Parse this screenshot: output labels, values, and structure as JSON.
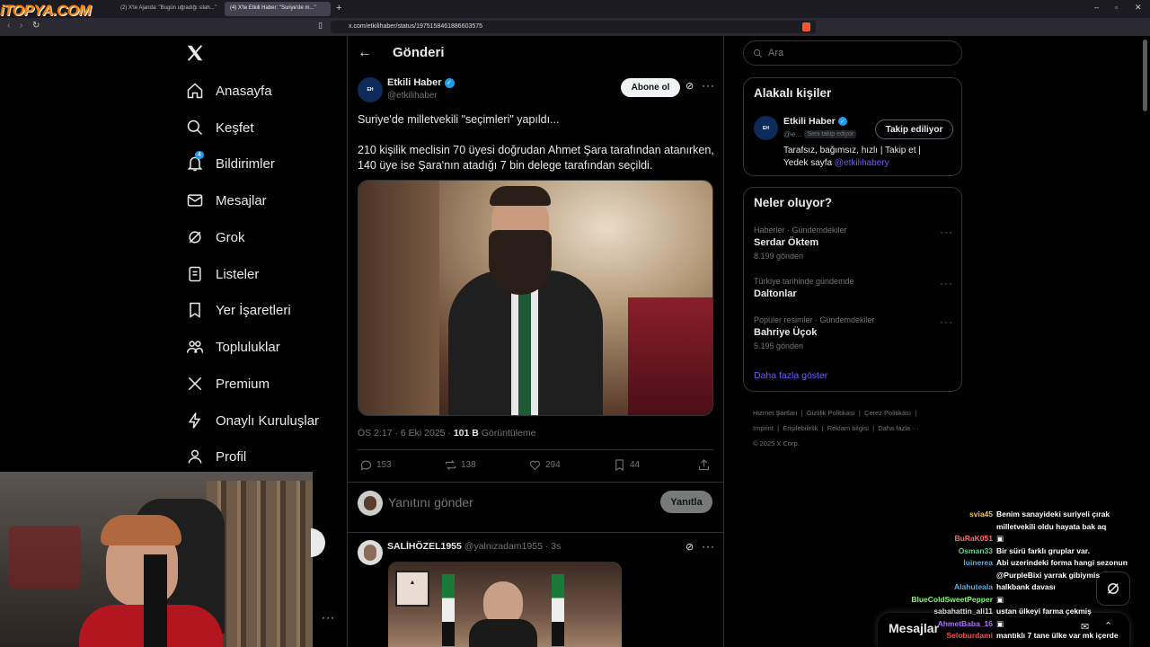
{
  "browser": {
    "brand": "iTOPYA.COM",
    "tabs": [
      {
        "label": "(2) X'te Ajanda: \"Bugün uğradığı silah...\""
      },
      {
        "label": "(4) X'te Etkili Haber: \"Suriye'de m...\""
      }
    ],
    "url": "x.com/etkilihaber/status/1975158461886603575"
  },
  "nav": {
    "items": [
      {
        "label": "Anasayfa"
      },
      {
        "label": "Keşfet"
      },
      {
        "label": "Bildirimler",
        "badge": "4"
      },
      {
        "label": "Mesajlar"
      },
      {
        "label": "Grok"
      },
      {
        "label": "Listeler"
      },
      {
        "label": "Yer İşaretleri"
      },
      {
        "label": "Topluluklar"
      },
      {
        "label": "Premium"
      },
      {
        "label": "Onaylı Kuruluşlar"
      },
      {
        "label": "Profil"
      }
    ]
  },
  "header": {
    "title": "Gönderi"
  },
  "post": {
    "author_name": "Etkili Haber",
    "author_handle": "@etkilihaber",
    "subscribe_label": "Abone ol",
    "text_line1": "Suriye'de milletvekili \"seçimleri\" yapıldı...",
    "text_line2": "210 kişilik meclisin 70 üyesi doğrudan Ahmet Şara tarafından atanırken,",
    "text_line3": "140 üye ise Şara'nın atadığı 7 bin delege tarafından seçildi.",
    "time": "ÖS 2:17 · 6 Eki 2025 · ",
    "views_count": "101 B",
    "views_label": " Görüntüleme",
    "replies": "153",
    "reposts": "138",
    "likes": "294",
    "bookmarks": "44"
  },
  "reply_box": {
    "placeholder": "Yanıtını gönder",
    "button": "Yanıtla"
  },
  "reply": {
    "author_name": "SALİHÖZEL1955",
    "author_handle": "@yalnizadam1955",
    "time": "· 3s"
  },
  "search": {
    "placeholder": "Ara"
  },
  "related": {
    "title": "Alakalı kişiler",
    "name": "Etkili Haber",
    "handle": "@e...",
    "follows_you": "Seni takip ediyor",
    "following_label": "Takip ediliyor",
    "bio_line1": "Tarafsız, bağımsız, hızlı | Takip et |",
    "bio_prefix": "Yedek sayfa ",
    "bio_link": "@etkilihabery"
  },
  "trends": {
    "title": "Neler oluyor?",
    "items": [
      {
        "category": "Haberler · Gündemdekiler",
        "name": "Serdar Öktem",
        "count": "8.199 gönderi"
      },
      {
        "category": "Türkiye tarihinde gündemde",
        "name": "Daltonlar",
        "count": ""
      },
      {
        "category": "Popüler resimler · Gündemdekiler",
        "name": "Bahriye Üçok",
        "count": "5.195 gönderi"
      }
    ],
    "show_more": "Daha fazla göster"
  },
  "footer": {
    "links": [
      "Hizmet Şartları",
      "Gizlilik Politikası",
      "Çerez Politikası",
      "Imprint",
      "Erişilebilirlik",
      "Reklam bilgisi",
      "Daha fazla ···"
    ],
    "copyright": "© 2025 X Corp."
  },
  "messages_dock": {
    "label": "Mesajlar"
  },
  "chat": [
    {
      "user": "svia45",
      "color": "#f5c542",
      "text": "Benim sanayideki suriyeli çırak"
    },
    {
      "user": "",
      "color": "#ffffff",
      "text": "milletvekili oldu hayata bak aq"
    },
    {
      "user": "BuRaK051",
      "color": "#ff6b6b",
      "text": "▣"
    },
    {
      "user": "Osman33",
      "color": "#58d68d",
      "text": "Bir sürü farklı gruplar var."
    },
    {
      "user": "luinerea",
      "color": "#5dade2",
      "text": "Abi uzerindeki forma hangi sezonun"
    },
    {
      "user": "",
      "color": "#ffffff",
      "text": "@PurpleBixi yarrak gibiymis"
    },
    {
      "user": "Alahuteala",
      "color": "#5dade2",
      "text": "halkbank davası"
    },
    {
      "user": "BlueColdSweetPepper",
      "color": "#7dff6b",
      "text": "▣"
    },
    {
      "user": "sabahattin_ali11",
      "color": "#dddddd",
      "text": "ustan ülkeyi farma çekmiş"
    },
    {
      "user": "AhmetBaba_16",
      "color": "#b26bff",
      "text": "▣"
    },
    {
      "user": "Seloburdami",
      "color": "#ff4d4d",
      "text": "mantıklı 7 tane ülke var mk içerde"
    }
  ],
  "colors": {
    "accent": "#1d9bf0",
    "link": "#7856ff",
    "bg": "#000000",
    "border": "#2f3336"
  }
}
